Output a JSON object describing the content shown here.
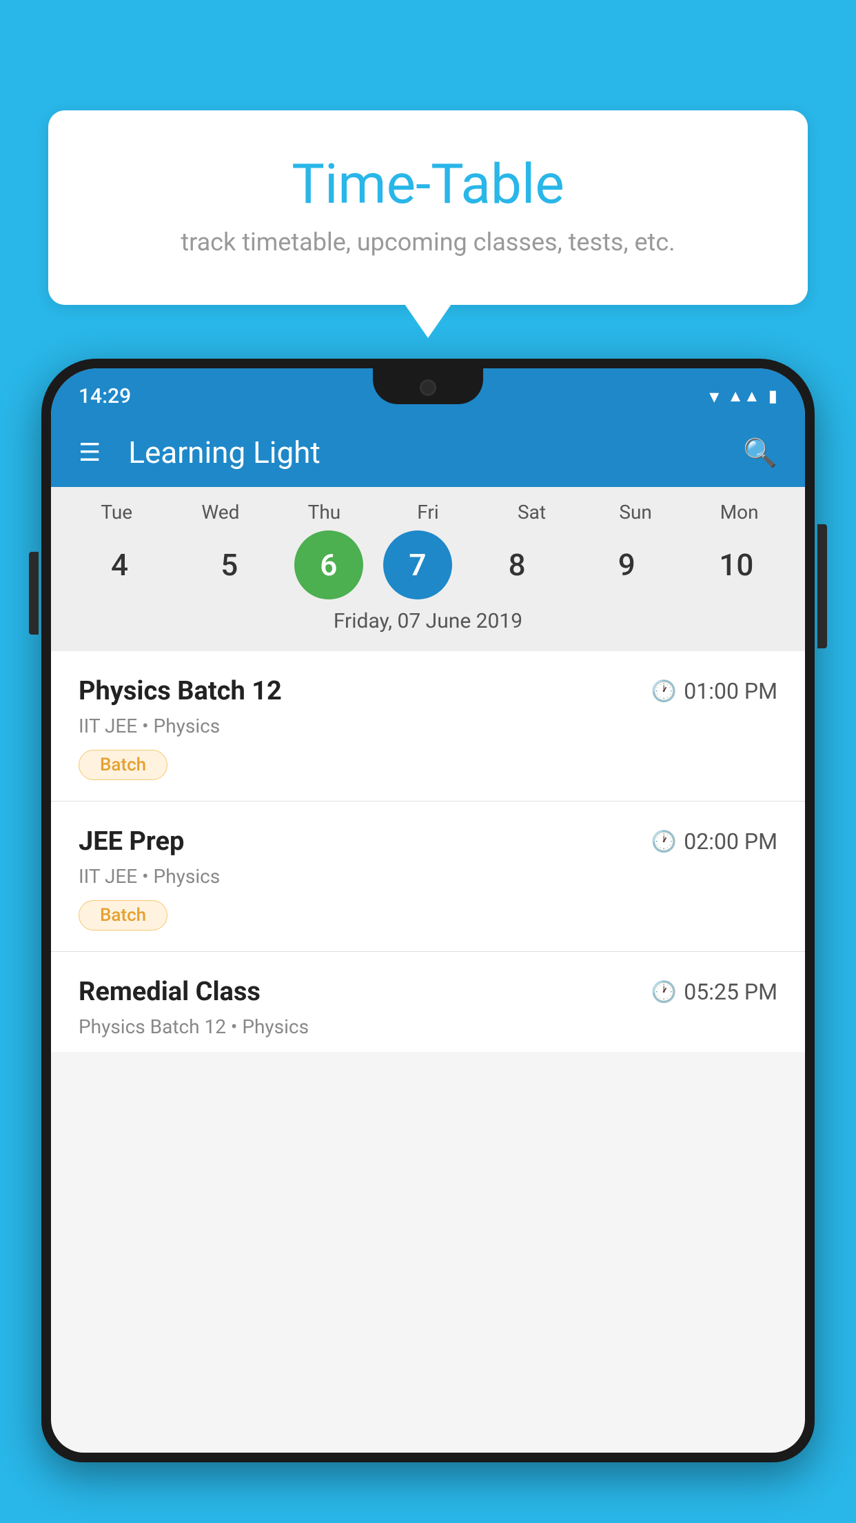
{
  "background_color": "#29b6e8",
  "tooltip": {
    "title": "Time-Table",
    "subtitle": "track timetable, upcoming classes, tests, etc."
  },
  "phone": {
    "status_bar": {
      "time": "14:29"
    },
    "app_bar": {
      "title": "Learning Light"
    },
    "calendar": {
      "days": [
        "Tue",
        "Wed",
        "Thu",
        "Fri",
        "Sat",
        "Sun",
        "Mon"
      ],
      "dates": [
        "4",
        "5",
        "6",
        "7",
        "8",
        "9",
        "10"
      ],
      "today_index": 2,
      "selected_index": 3,
      "selected_label": "Friday, 07 June 2019"
    },
    "schedule": [
      {
        "title": "Physics Batch 12",
        "time": "01:00 PM",
        "subtitle": "IIT JEE • Physics",
        "badge": "Batch"
      },
      {
        "title": "JEE Prep",
        "time": "02:00 PM",
        "subtitle": "IIT JEE • Physics",
        "badge": "Batch"
      },
      {
        "title": "Remedial Class",
        "time": "05:25 PM",
        "subtitle": "Physics Batch 12 • Physics",
        "badge": null
      }
    ]
  }
}
